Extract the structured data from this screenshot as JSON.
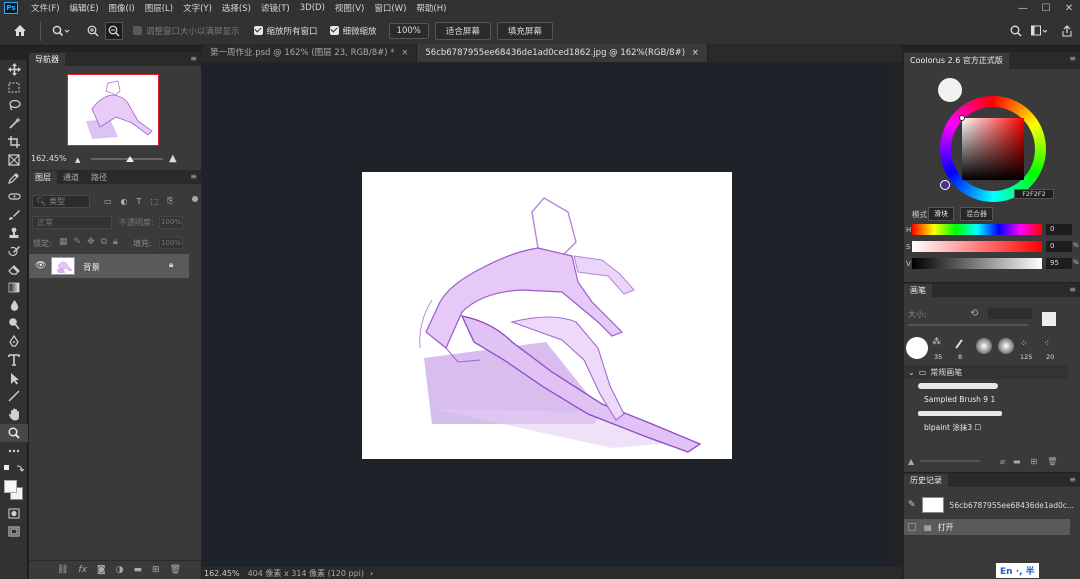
{
  "app": {
    "logo": "Ps"
  },
  "menu": [
    "文件(F)",
    "编辑(E)",
    "图像(I)",
    "图层(L)",
    "文字(Y)",
    "选择(S)",
    "滤镜(T)",
    "3D(D)",
    "视图(V)",
    "窗口(W)",
    "帮助(H)"
  ],
  "window_controls": {
    "minimize": "—",
    "maximize": "☐",
    "close": "✕"
  },
  "options": {
    "resize_windows": "调整窗口大小以满屏显示",
    "zoom_all": "缩放所有窗口",
    "scrubby_zoom": "细微缩放",
    "zoom_value": "100%",
    "fit_screen": "适合屏幕",
    "fill_screen": "填充屏幕"
  },
  "tabs": [
    {
      "label": "第一周作业.psd @ 162% (图层 23, RGB/8#) *",
      "close": "×"
    },
    {
      "label": "56cb6787955ee68436de1ad0ced1862.jpg @ 162%(RGB/8#)",
      "close": "×"
    }
  ],
  "navigator": {
    "tab": "导航器",
    "zoom": "162.45%"
  },
  "layers": {
    "tabs": [
      "图层",
      "通道",
      "路径"
    ],
    "filter_type": "类型",
    "blend_mode": "正常",
    "opacity_label": "不透明度:",
    "opacity_value": "100%",
    "lock_label": "锁定:",
    "fill_label": "填充:",
    "fill_value": "100%",
    "items": [
      {
        "name": "背景"
      }
    ]
  },
  "status": {
    "zoom": "162.45%",
    "doc_info": "404 像素 x 314 像素 (120 ppi)",
    "arrow": "›"
  },
  "coolorus": {
    "tab": "Coolorus 2.6 官方正式版",
    "hex": "F2F2F2",
    "mode_label": "模式",
    "mode_slider": "滑块",
    "mode_mixer": "混合器",
    "h_label": "H",
    "h_value": "0",
    "s_label": "S",
    "s_value": "0",
    "v_label": "V",
    "v_value": "95",
    "percent": "%"
  },
  "brushes": {
    "tab": "画笔",
    "size_label": "大小:",
    "sizes": [
      "35",
      "8",
      "125",
      "20"
    ],
    "group_name": "常规画笔",
    "items": [
      "Sampled Brush 9 1",
      "blpaint 涂抹3 ☐"
    ]
  },
  "history": {
    "tab": "历史记录",
    "snapshot": "56cb6787955ee68436de1ad0c...",
    "items": [
      "打开"
    ]
  },
  "ime": {
    "text": "En ·, 半"
  },
  "colors": {
    "accent_red": "#e0202a",
    "panel": "#3a3a3a",
    "canvas_bg": "#1e2329"
  }
}
